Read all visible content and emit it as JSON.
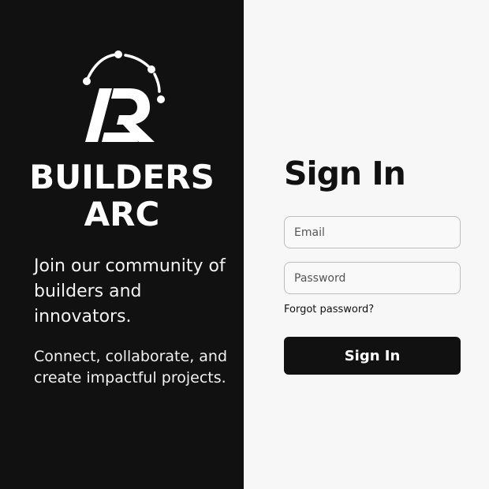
{
  "brand": {
    "logo_icon": "builders-arc-logo",
    "name_line1": "BUILDERS",
    "name_line2": "ARC",
    "tagline_1": "Join our community of builders and innovators.",
    "tagline_2": "Connect, collaborate, and create impactful projects."
  },
  "signin": {
    "title": "Sign In",
    "email_placeholder": "Email",
    "password_placeholder": "Password",
    "forgot_label": "Forgot password?",
    "submit_label": "Sign In"
  },
  "colors": {
    "brand_panel": "#111111",
    "signin_panel": "#f7f7f7",
    "button": "#111111"
  }
}
